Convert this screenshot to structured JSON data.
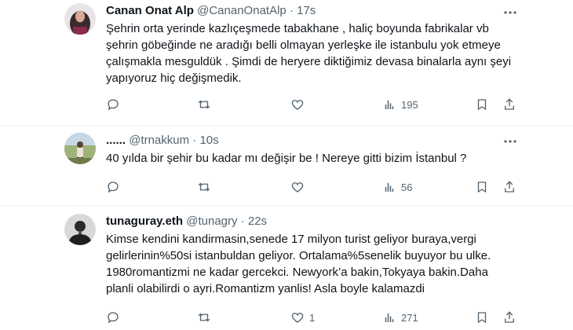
{
  "tweets": [
    {
      "name": "Canan Onat Alp",
      "handle": "@CananOnatAlp",
      "separator": "·",
      "time": "17s",
      "text": "Şehrin orta yerinde kazlıçeşmede tabakhane , haliç boyunda fabrikalar vb şehrin göbeğinde ne aradığı belli olmayan yerleşke ile istanbulu yok etmeye çalışmakla mesguldük . Şimdi de heryere diktiğimiz devasa binalarla aynı şeyi yapıyoruz hiç değişmedik.",
      "views": "195",
      "likes": ""
    },
    {
      "name": "......",
      "handle": "@trnakkum",
      "separator": "·",
      "time": "10s",
      "text": "40 yılda bir şehir bu kadar mı değişir be ! Nereye gitti bizim İstanbul ?",
      "views": "56",
      "likes": ""
    },
    {
      "name": "tunaguray.eth",
      "handle": "@tunagry",
      "separator": "·",
      "time": "22s",
      "text": "Kimse kendini kandirmasin,senede 17 milyon turist geliyor buraya,vergi gelirlerinin%50si istanbuldan geliyor. Ortalama%5senelik buyuyor bu ulke. 1980romantizmi ne kadar gercekci. Newyork’a bakin,Tokyaya bakin.Daha planli olabilirdi o ayri.Romantizm yanlis! Asla boyle kalamazdi",
      "views": "271",
      "likes": "1"
    }
  ],
  "colors": {
    "text": "#0f1419",
    "secondary": "#536471",
    "divider": "#eff3f4"
  },
  "icons": [
    "more-icon",
    "reply-icon",
    "retweet-icon",
    "like-icon",
    "views-icon",
    "bookmark-icon",
    "share-icon"
  ]
}
